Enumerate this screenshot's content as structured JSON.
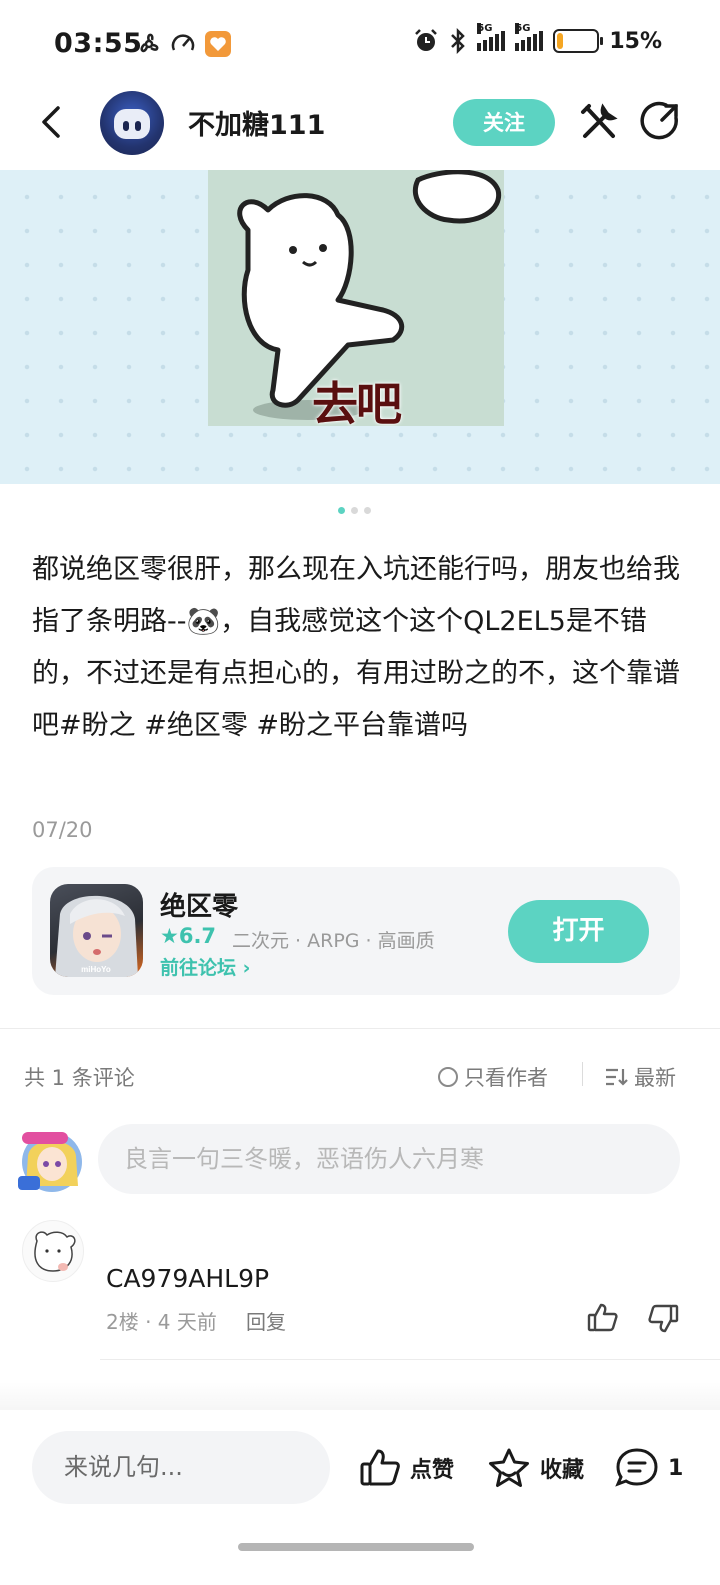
{
  "status_bar": {
    "time": "03:55",
    "battery": "15%",
    "battery_level": 0.15,
    "net1": "5G",
    "net2": "5G"
  },
  "header": {
    "username": "不加糖111",
    "follow_label": "关注"
  },
  "media": {
    "meme_caption": "去吧",
    "page_count": 3,
    "active_index": 0
  },
  "post": {
    "content": "都说绝区零很肝，那么现在入坑还能行吗，朋友也给我指了条明路--🐼，自我感觉这个这个QL2EL5是不错的，不过还是有点担心的，有用过盼之的不，这个靠谱吧#盼之 #绝区零 #盼之平台靠谱吗",
    "date": "07/20"
  },
  "game_card": {
    "name": "绝区零",
    "rating": "★6.7",
    "tags": "二次元 · ARPG · 高画质",
    "forum_link": "前往论坛 ›",
    "open_label": "打开",
    "icon_text": "miHoYo"
  },
  "comments": {
    "count_label": "共 1 条评论",
    "author_only_label": "只看作者",
    "sort_label": "最新",
    "input_placeholder": "良言一句三冬暖，恶语伤人六月寒",
    "items": [
      {
        "user": "CA979AHL9P",
        "meta": "2楼 · 4 天前",
        "reply_label": "回复"
      }
    ]
  },
  "bottom_bar": {
    "say_placeholder": "来说几句...",
    "like_label": "点赞",
    "favorite_label": "收藏",
    "comment_count": "1"
  },
  "colors": {
    "accent": "#5cd3c2",
    "accent_text": "#3ec2ae",
    "banner_bg": "#def0f7"
  }
}
